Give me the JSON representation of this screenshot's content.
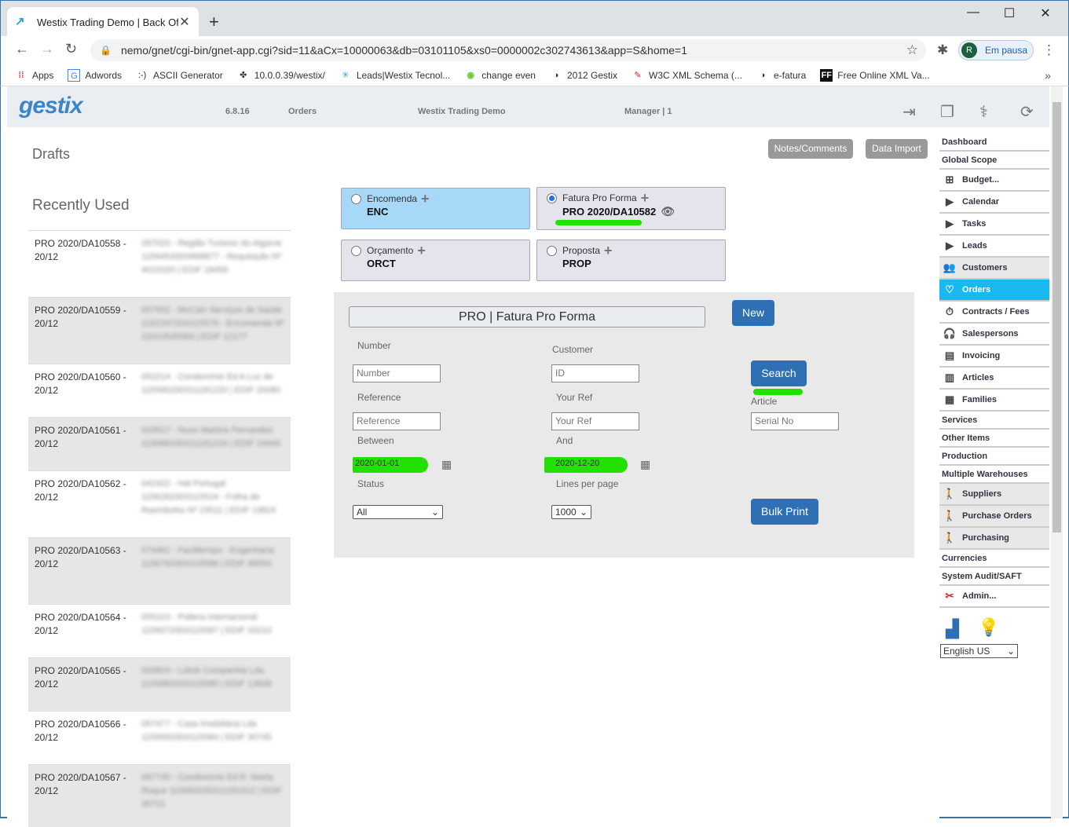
{
  "browser": {
    "tab_title": "Westix Trading Demo | Back Offic",
    "url": "nemo/gnet/cgi-bin/gnet-app.cgi?sid=11&aCx=10000063&db=03101105&xs0=0000002c302743613&app=S&home=1",
    "profile_initial": "R",
    "profile_label": "Em pausa",
    "bookmarks": [
      "Apps",
      "Adwords",
      "ASCII Generator",
      "10.0.0.39/westix/",
      "Leads|Westix Tecnol...",
      "change even",
      "2012 Gestix",
      "W3C XML Schema (...",
      "e-fatura",
      "Free Online XML Va..."
    ]
  },
  "header": {
    "logo": "gestix",
    "version": "6.8.16",
    "module": "Orders",
    "company": "Westix Trading Demo",
    "user": "Manager | 1"
  },
  "main": {
    "drafts_title": "Drafts",
    "recent_title": "Recently Used",
    "notes_button": "Notes/Comments",
    "import_button": "Data Import"
  },
  "recent": [
    {
      "code": "PRO 2020/DA10558 - 20/12",
      "desc": "097020 - Região Turismo do Algarve 11594530D0998877 - Requisição Nº 4022020 | EDIF 18456"
    },
    {
      "code": "PRO 2020/DA10559 - 20/12",
      "desc": "007552 - McCain Serviços de Saúde 11623372D0115579 - Encomenda Nº 22010545584 | EDIF 12177"
    },
    {
      "code": "PRO 2020/DA10560 - 20/12",
      "desc": "052214 - Condomínio Ed A Luz de 11556620D011181220 | EDIF 20080"
    },
    {
      "code": "PRO 2020/DA10561 - 20/12",
      "desc": "043917 - Nuno Martins Fernandes 11568820D011181224 | EDIF 24440"
    },
    {
      "code": "PRO 2020/DA10562 - 20/12",
      "desc": "042422 - Hdi Portugal 11562820D0115524 - Folha de Reembolso Nº 23511 | EDIF 13824"
    },
    {
      "code": "PRO 2020/DA10563 - 20/12",
      "desc": "074462 - Facilitempo - Engenharia 11567920D0115586 | EDIF 48550"
    },
    {
      "code": "PRO 2020/DA10564 - 20/12",
      "desc": "055223 - Poltera Internacional 11560720D0115587 | EDIF 33210"
    },
    {
      "code": "PRO 2020/DA10565 - 20/12",
      "desc": "000824 - Lidnik Companhia Lda 11558820D0115585 | EDIF 13838"
    },
    {
      "code": "PRO 2020/DA10566 - 20/12",
      "desc": "057477 - Casa Imobiliária Lda 11556920D0115584 | EDIF 30745"
    },
    {
      "code": "PRO 2020/DA10567 - 20/12",
      "desc": "097745 - Condomínio Ed R. Marta Roque 11558320D011181512 | EDIF 35721"
    }
  ],
  "doc_types": [
    {
      "label": "Encomenda",
      "code": "ENC"
    },
    {
      "label": "Fatura Pro Forma",
      "code": "PRO 2020/DA10582"
    },
    {
      "label": "Orçamento",
      "code": "ORCT"
    },
    {
      "label": "Proposta",
      "code": "PROP"
    }
  ],
  "form": {
    "title": "PRO | Fatura Pro Forma",
    "new_button": "New",
    "search_button": "Search",
    "bulk_print_button": "Bulk Print",
    "labels": {
      "number": "Number",
      "customer": "Customer",
      "reference": "Reference",
      "your_ref": "Your Ref",
      "article": "Article",
      "between": "Between",
      "and": "And",
      "status": "Status",
      "lines_per_page": "Lines per page"
    },
    "placeholders": {
      "number": "Number",
      "customer": "ID",
      "reference": "Reference",
      "your_ref": "Your Ref",
      "article": "Serial No"
    },
    "date_from": "2020-01-01",
    "date_to": "2020-12-20",
    "status": "All",
    "lines_per_page": "1000"
  },
  "sidebar": {
    "items": [
      "Dashboard",
      "Global Scope",
      "Budget...",
      "Calendar",
      "Tasks",
      "Leads",
      "Customers",
      "Orders",
      "Contracts / Fees",
      "Salespersons",
      "Invoicing",
      "Articles",
      "Families",
      "Services",
      "Other Items",
      "Production",
      "Multiple Warehouses",
      "Suppliers",
      "Purchase Orders",
      "Purchasing",
      "Currencies",
      "System Audit/SAFT",
      "Admin..."
    ],
    "language": "English US"
  },
  "colors": {
    "accent": "#18b8f0",
    "button_blue": "#2f6fb3",
    "highlight": "#22e000",
    "card_selected": "#a8d8f8"
  }
}
